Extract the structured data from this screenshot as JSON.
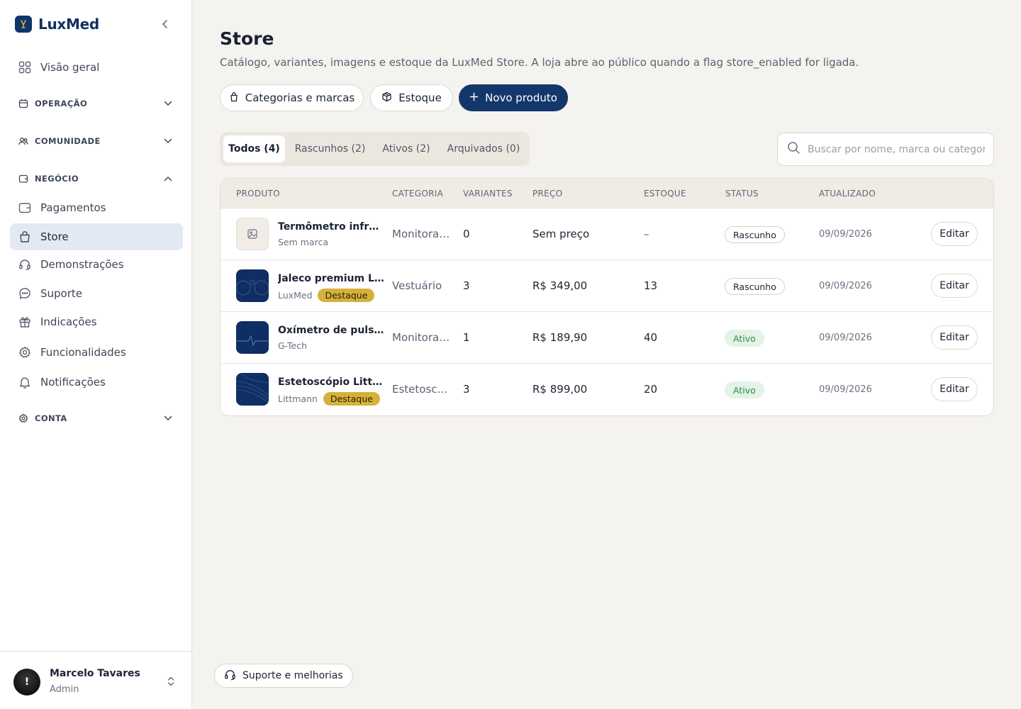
{
  "brand": {
    "name": "LuxMed"
  },
  "sidebar": {
    "overview": {
      "label": "Visão geral",
      "icon": "grid-icon"
    },
    "sections": {
      "operacao": {
        "label": "OPERAÇÃO",
        "icon": "calendar-icon",
        "expanded": false
      },
      "comunidade": {
        "label": "COMUNIDADE",
        "icon": "users-icon",
        "expanded": false
      },
      "negocio": {
        "label": "NEGÓCIO",
        "icon": "wallet-icon",
        "expanded": true
      },
      "conta": {
        "label": "CONTA",
        "icon": "gear-icon",
        "expanded": false
      }
    },
    "business_items": [
      {
        "label": "Pagamentos",
        "icon": "wallet-icon",
        "active": false
      },
      {
        "label": "Store",
        "icon": "shopping-bag-icon",
        "active": true
      },
      {
        "label": "Demonstrações",
        "icon": "headset-icon",
        "active": false
      },
      {
        "label": "Suporte",
        "icon": "chat-bubble-icon",
        "active": false
      },
      {
        "label": "Indicações",
        "icon": "gift-icon",
        "active": false
      },
      {
        "label": "Funcionalidades",
        "icon": "gear-icon",
        "active": false
      },
      {
        "label": "Notificações",
        "icon": "bell-icon",
        "active": false
      }
    ]
  },
  "user": {
    "name": "Marcelo Tavares",
    "role": "Admin",
    "avatar_glyph": "!"
  },
  "header": {
    "title": "Store",
    "subtitle": "Catálogo, variantes, imagens e estoque da LuxMed Store. A loja abre ao público quando a flag store_enabled for ligada."
  },
  "actions": {
    "categories": "Categorias e marcas",
    "stock": "Estoque",
    "new_product": "Novo produto"
  },
  "tabs": [
    {
      "label": "Todos (4)",
      "active": true
    },
    {
      "label": "Rascunhos (2)",
      "active": false
    },
    {
      "label": "Ativos (2)",
      "active": false
    },
    {
      "label": "Arquivados (0)",
      "active": false
    }
  ],
  "search": {
    "placeholder": "Buscar por nome, marca ou categoria",
    "value": ""
  },
  "table": {
    "columns": [
      "PRODUTO",
      "CATEGORIA",
      "VARIANTES",
      "PREÇO",
      "ESTOQUE",
      "STATUS",
      "ATUALIZADO"
    ],
    "edit_label": "Editar",
    "featured_label": "Destaque",
    "rows": [
      {
        "name": "Termômetro infravermelho",
        "brand": "Sem marca",
        "featured": false,
        "thumb": "image-placeholder-icon",
        "category": "Monitoramento",
        "variants": "0",
        "price": "Sem preço",
        "stock": "–",
        "status": "Rascunho",
        "status_kind": "draft",
        "updated": "09/09/2026"
      },
      {
        "name": "Jaleco premium LuxMed",
        "brand": "LuxMed",
        "featured": true,
        "thumb": "circles-pattern-icon",
        "category": "Vestuário",
        "variants": "3",
        "price": "R$ 349,00",
        "stock": "13",
        "status": "Rascunho",
        "status_kind": "draft",
        "updated": "09/09/2026"
      },
      {
        "name": "Oxímetro de pulso G-Tech",
        "brand": "G-Tech",
        "featured": false,
        "thumb": "pulse-line-icon",
        "category": "Monitoramento",
        "variants": "1",
        "price": "R$ 189,90",
        "stock": "40",
        "status": "Ativo",
        "status_kind": "active",
        "updated": "09/09/2026"
      },
      {
        "name": "Estetoscópio Littmann",
        "brand": "Littmann",
        "featured": true,
        "thumb": "waves-pattern-icon",
        "category": "Estetoscópios",
        "variants": "3",
        "price": "R$ 899,00",
        "stock": "20",
        "status": "Ativo",
        "status_kind": "active",
        "updated": "09/09/2026"
      }
    ]
  },
  "footer": {
    "support_label": "Suporte e melhorias"
  },
  "colors": {
    "primary": "#13376b",
    "featured": "#d6b13a",
    "active_bg": "#e3f3e6",
    "active_text": "#2f8a48",
    "canvas": "#f5f3ef"
  }
}
